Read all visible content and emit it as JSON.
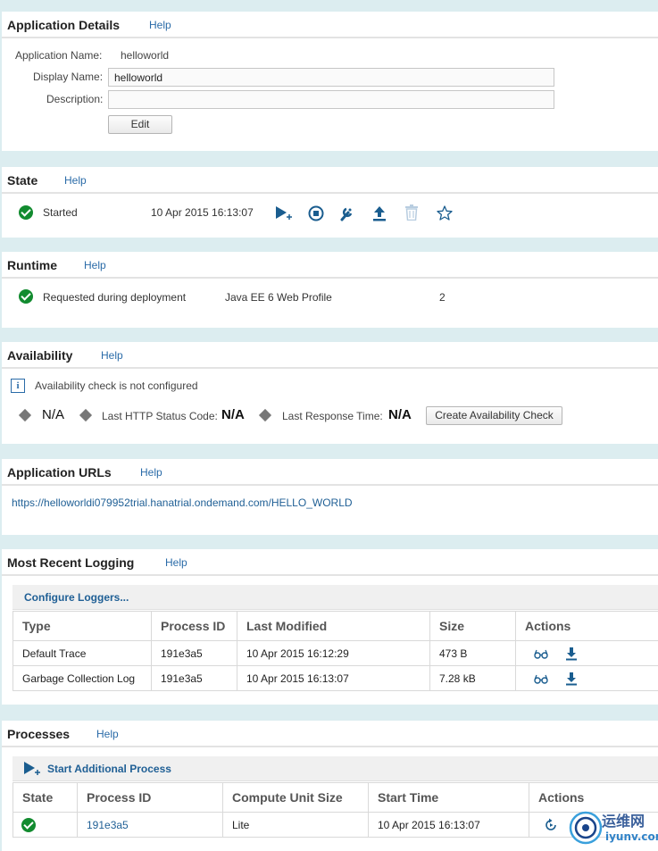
{
  "details": {
    "title": "Application Details",
    "help": "Help",
    "app_name_label": "Application Name:",
    "app_name_value": "helloworld",
    "display_name_label": "Display Name:",
    "display_name_value": "helloworld",
    "description_label": "Description:",
    "description_value": "",
    "edit_button": "Edit"
  },
  "state": {
    "title": "State",
    "help": "Help",
    "status": "Started",
    "timestamp": "10 Apr 2015 16:13:07",
    "actions": [
      "start-icon",
      "stop-icon",
      "wrench-icon",
      "update-icon",
      "delete-icon",
      "star-icon"
    ]
  },
  "runtime": {
    "title": "Runtime",
    "help": "Help",
    "status": "Requested during deployment",
    "name": "Java EE 6 Web Profile",
    "version": "2"
  },
  "availability": {
    "title": "Availability",
    "help": "Help",
    "info": "Availability check is not configured",
    "status_value": "N/A",
    "http_label": "Last HTTP Status Code:",
    "http_value": "N/A",
    "response_label": "Last Response Time:",
    "response_value": "N/A",
    "create_button": "Create Availability Check"
  },
  "urls": {
    "title": "Application URLs",
    "help": "Help",
    "url": "https://helloworldi079952trial.hanatrial.ondemand.com/HELLO_WORLD"
  },
  "logging": {
    "title": "Most Recent Logging",
    "help": "Help",
    "configure": "Configure Loggers...",
    "columns": [
      "Type",
      "Process ID",
      "Last Modified",
      "Size",
      "Actions"
    ],
    "rows": [
      {
        "type": "Default Trace",
        "pid": "191e3a5",
        "modified": "10 Apr 2015 16:12:29",
        "size": "473 B"
      },
      {
        "type": "Garbage Collection Log",
        "pid": "191e3a5",
        "modified": "10 Apr 2015 16:13:07",
        "size": "7.28 kB"
      }
    ]
  },
  "processes": {
    "title": "Processes",
    "help": "Help",
    "start_label": "Start Additional Process",
    "columns": [
      "State",
      "Process ID",
      "Compute Unit Size",
      "Start Time",
      "Actions"
    ],
    "rows": [
      {
        "pid": "191e3a5",
        "size": "Lite",
        "start": "10 Apr 2015 16:13:07"
      }
    ]
  },
  "watermark": {
    "cn": "运维网",
    "domain": "iyunv.com"
  },
  "colors": {
    "background": "#dcedf0",
    "link": "#1f5f95",
    "success": "#128b2f"
  }
}
